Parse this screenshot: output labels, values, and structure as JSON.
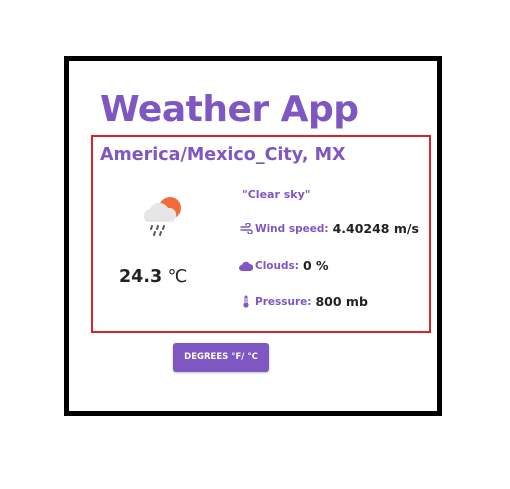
{
  "app": {
    "title": "Weather App"
  },
  "weather": {
    "location": "America/Mexico_City, MX",
    "icon": "cloud-sun-rain-icon",
    "temperature_value": "24.3",
    "temperature_unit": "℃",
    "description": "\"Clear sky\"",
    "wind": {
      "icon": "wind-icon",
      "label": "Wind speed:",
      "value": "4.40248 m/s"
    },
    "clouds": {
      "icon": "cloud-icon",
      "label": "Clouds:",
      "value": "0 %"
    },
    "pressure": {
      "icon": "thermometer-icon",
      "label": "Pressure:",
      "value": "800 mb"
    }
  },
  "controls": {
    "toggle_units_label": "DEGREES °F/ °C"
  },
  "colors": {
    "accent": "#7f57c2",
    "card_border": "#d6262c",
    "frame_border": "#000000",
    "sun": "#f26b3a",
    "text": "#222222"
  }
}
